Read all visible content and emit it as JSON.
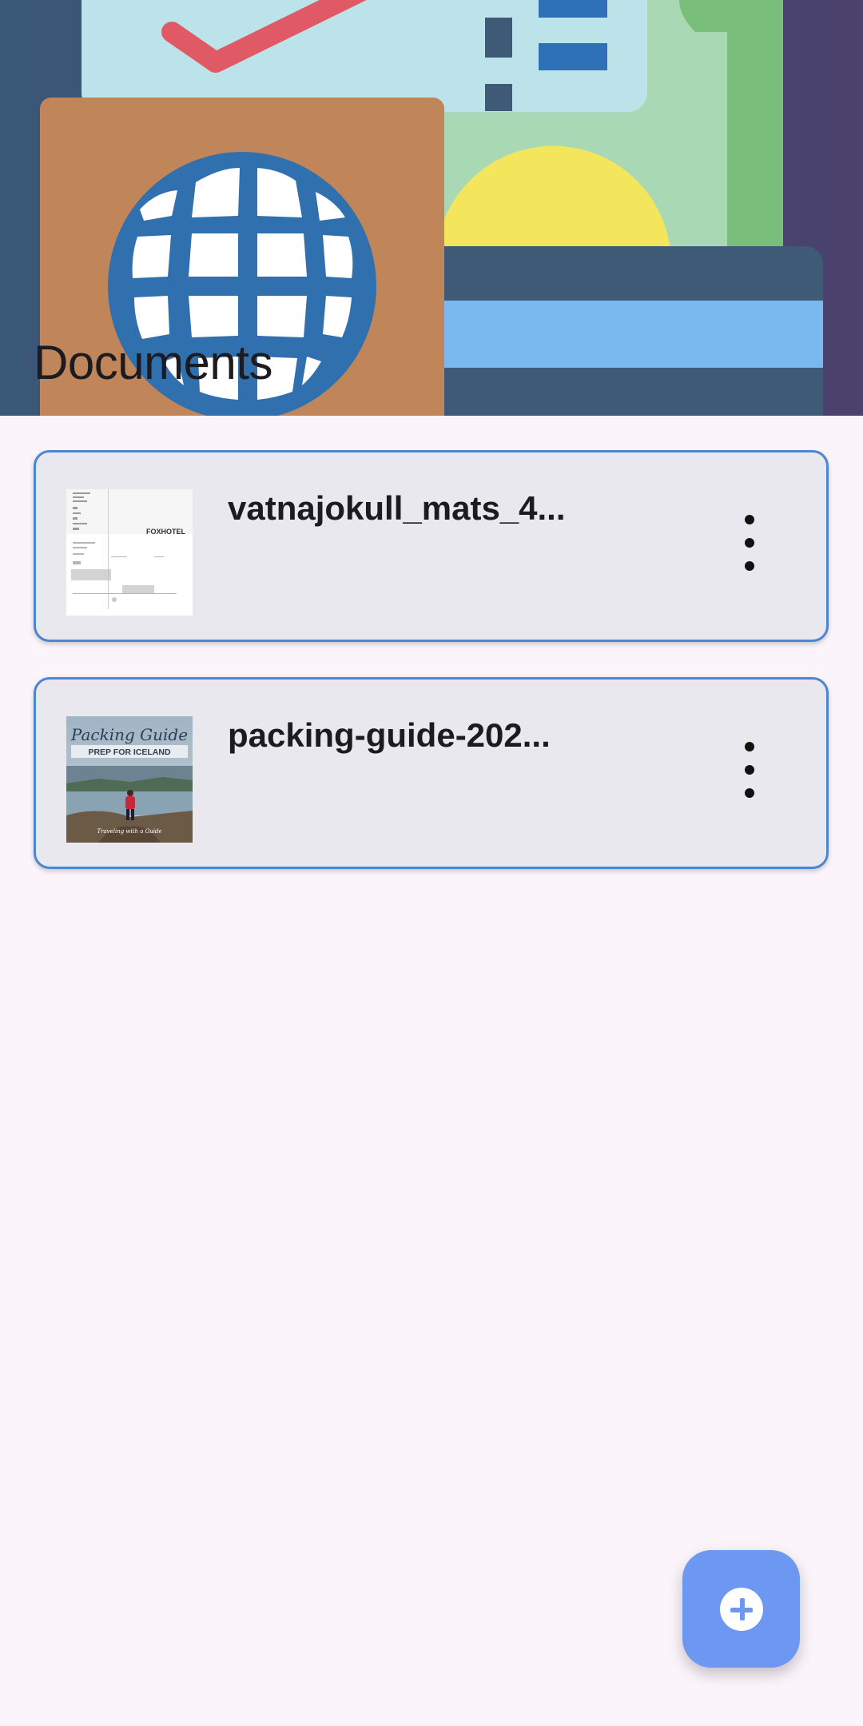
{
  "page": {
    "title": "Documents"
  },
  "documents": [
    {
      "name": "vatnajokull_mats_4...",
      "thumbnail_icon": "pdf-document-thumbnail",
      "thumb_text": "FOXHOTEL"
    },
    {
      "name": "packing-guide-202...",
      "thumbnail_icon": "packing-guide-cover-thumbnail",
      "thumb_title": "Packing Guide",
      "thumb_subtitle": "PREP FOR ICELAND"
    }
  ],
  "fab": {
    "icon": "add-circle-icon"
  },
  "colors": {
    "background": "#fbf4fb",
    "card_bg": "#e9e8ee",
    "card_border": "#4a86d4",
    "fab": "#6d98f2"
  }
}
